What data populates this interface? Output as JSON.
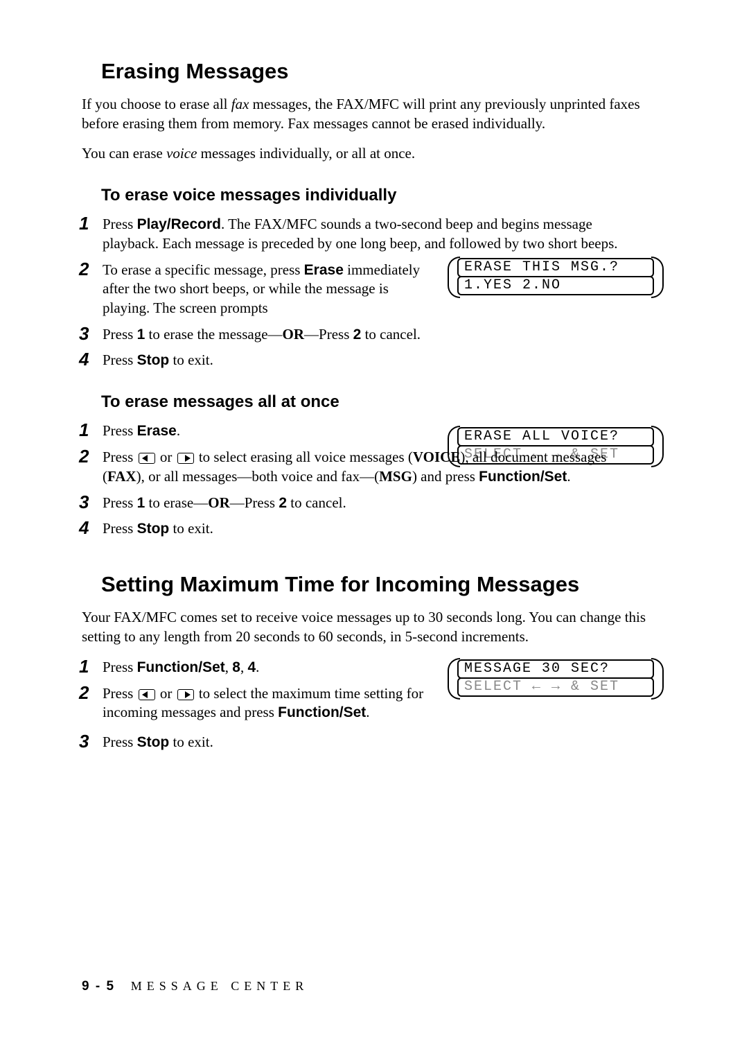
{
  "section1": {
    "title": "Erasing Messages",
    "intro1_a": "If you choose to erase all ",
    "intro1_i": "fax",
    "intro1_b": " messages, the FAX/MFC will print any previously unprinted faxes before erasing them from memory. Fax messages cannot be erased individually.",
    "intro2_a": "You can erase ",
    "intro2_i": "voice",
    "intro2_b": " messages individually, or all at once.",
    "sub1": {
      "title": "To erase voice messages individually",
      "s1_a": "Press ",
      "s1_b": "Play/Record",
      "s1_c": ". The FAX/MFC sounds a two-second beep and begins message playback. Each message is preceded by one long beep, and followed by two short beeps.",
      "s2_a": "To erase a specific message, press ",
      "s2_b": "Erase",
      "s2_c": " immediately after the two short beeps, or while the message is playing. The screen prompts",
      "lcd2_line1": "ERASE THIS MSG.?",
      "lcd2_line2": "1.YES 2.NO",
      "s3_a": "Press ",
      "s3_b": "1",
      "s3_c": " to erase the message—",
      "s3_d": "OR",
      "s3_e": "—Press ",
      "s3_f": "2",
      "s3_g": " to cancel.",
      "s4_a": "Press ",
      "s4_b": "Stop",
      "s4_c": " to exit."
    },
    "sub2": {
      "title": "To erase messages all at once",
      "s1_a": "Press ",
      "s1_b": "Erase",
      "s1_c": ".",
      "lcd_line1": "ERASE ALL VOICE?",
      "lcd_line2": "SELECT ← → & SET",
      "s2_a": "Press ",
      "s2_b": " or ",
      "s2_c": " to select erasing all voice messages (",
      "s2_d": "VOICE",
      "s2_e": "), all document messages (",
      "s2_f": "FAX",
      "s2_g": "), or all messages—both voice and fax—(",
      "s2_h": "MSG",
      "s2_i": ") and press ",
      "s2_j": "Function/Set",
      "s2_k": ".",
      "s3_a": "Press ",
      "s3_b": "1",
      "s3_c": " to erase—",
      "s3_d": "OR",
      "s3_e": "—Press  ",
      "s3_f": "2",
      "s3_g": " to cancel.",
      "s4_a": "Press  ",
      "s4_b": "Stop",
      "s4_c": " to exit."
    }
  },
  "section2": {
    "title": "Setting Maximum Time for Incoming Messages",
    "intro": "Your FAX/MFC comes set to receive voice messages up to 30 seconds long. You can change this setting to any length from 20 seconds to 60 seconds, in 5-second increments.",
    "s1_a": "Press ",
    "s1_b": "Function/Set",
    "s1_c": ", ",
    "s1_d": "8",
    "s1_e": ", ",
    "s1_f": "4",
    "s1_g": ".",
    "lcd_line1": "MESSAGE 30 SEC?",
    "lcd_line2": "SELECT ← → & SET",
    "s2_a": "Press ",
    "s2_b": " or ",
    "s2_c": " to select the maximum time setting for incoming messages and press ",
    "s2_d": "Function/Set",
    "s2_e": ".",
    "s3_a": "Press ",
    "s3_b": "Stop",
    "s3_c": " to exit."
  },
  "footer": {
    "page": "9 - 5",
    "section": "MESSAGE CENTER"
  }
}
